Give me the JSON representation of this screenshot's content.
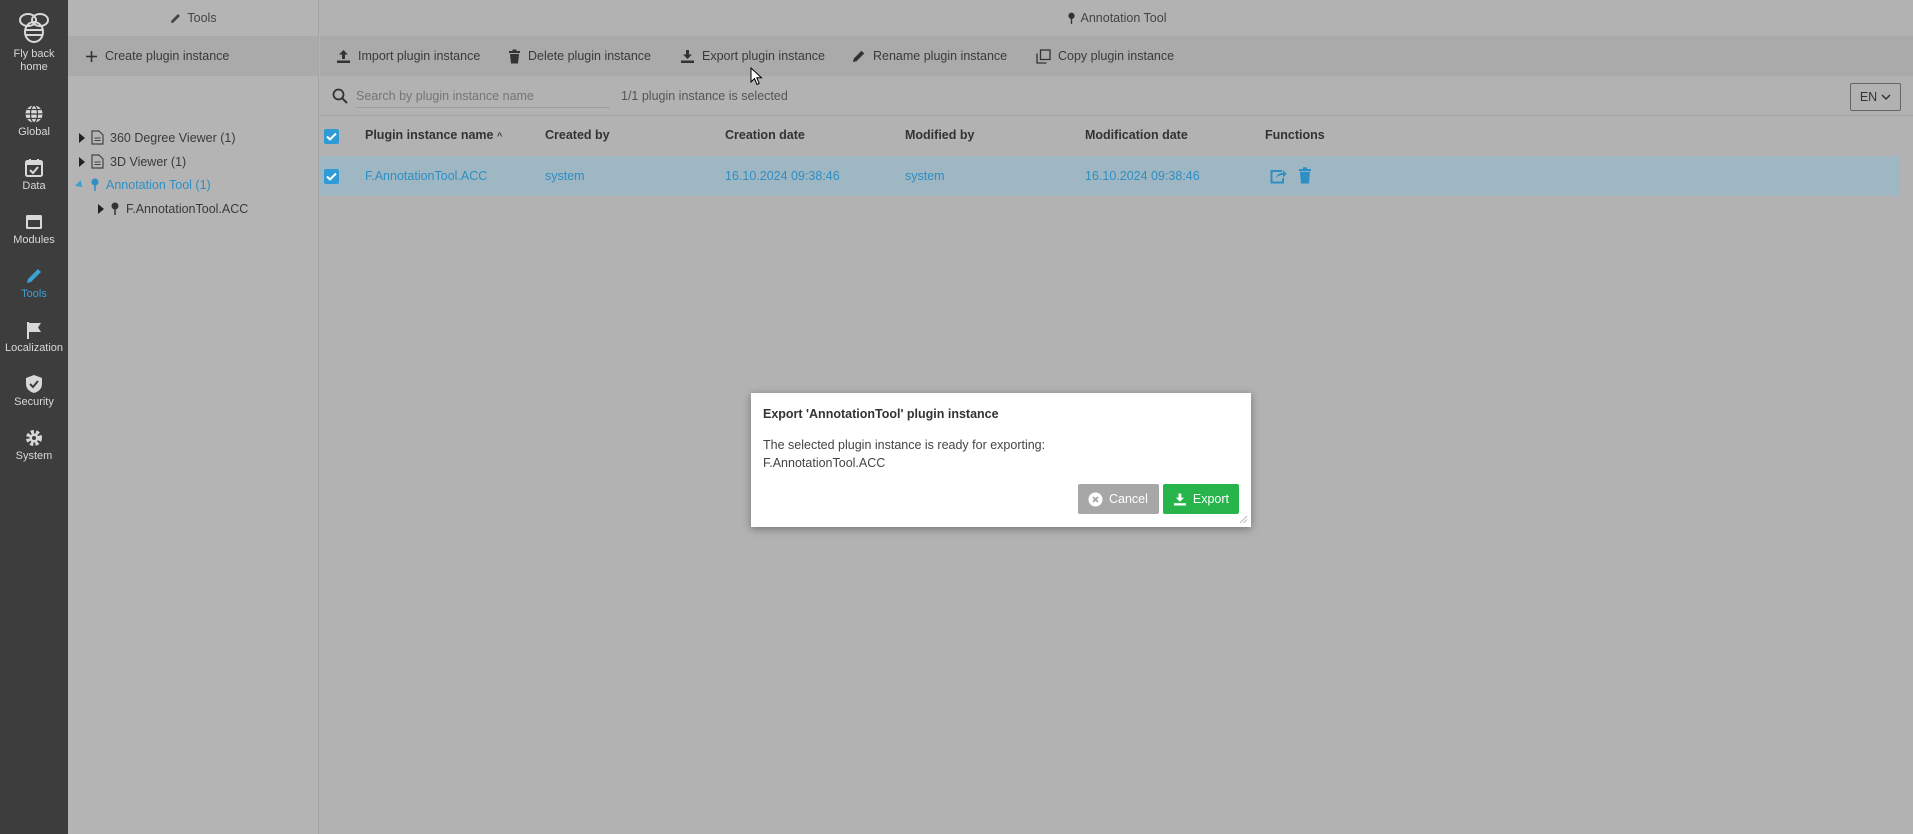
{
  "nav": {
    "items": [
      {
        "label_1": "Fly back",
        "label_2": "home",
        "icon": "bee-logo-icon"
      },
      {
        "label": "Global",
        "icon": "globe-icon"
      },
      {
        "label": "Data",
        "icon": "calendar-icon"
      },
      {
        "label": "Modules",
        "icon": "window-icon"
      },
      {
        "label": "Tools",
        "icon": "pencil-icon",
        "active": true
      },
      {
        "label": "Localization",
        "icon": "flag-icon"
      },
      {
        "label": "Security",
        "icon": "shield-icon"
      },
      {
        "label": "System",
        "icon": "gear-icon"
      }
    ]
  },
  "tree_panel": {
    "title": "Tools",
    "create_label": "Create plugin instance",
    "items": [
      {
        "label": "360 Degree Viewer (1)"
      },
      {
        "label": "3D Viewer (1)"
      },
      {
        "label": "Annotation Tool (1)"
      },
      {
        "label": "F.AnnotationTool.ACC"
      }
    ]
  },
  "main_panel": {
    "title": "Annotation Tool",
    "toolbar": {
      "import_label": "Import plugin instance",
      "delete_label": "Delete plugin instance",
      "export_label": "Export plugin instance",
      "rename_label": "Rename plugin instance",
      "copy_label": "Copy plugin instance"
    },
    "search": {
      "placeholder": "Search by plugin instance name",
      "selection_status": "1/1 plugin instance is selected"
    },
    "language": "EN",
    "table": {
      "headers": [
        "Plugin instance name",
        "Created by",
        "Creation date",
        "Modified by",
        "Modification date",
        "Functions"
      ],
      "rows": [
        {
          "name": "F.AnnotationTool.ACC",
          "created_by": "system",
          "creation_date": "16.10.2024 09:38:46",
          "modified_by": "system",
          "modification_date": "16.10.2024 09:38:46"
        }
      ]
    }
  },
  "dialog": {
    "title": "Export 'AnnotationTool' plugin instance",
    "message_1": "The selected plugin instance is ready for exporting:",
    "message_2": "F.AnnotationTool.ACC",
    "cancel_label": "Cancel",
    "export_label": "Export"
  },
  "colors": {
    "accent": "#3ca0d2",
    "export_green": "#27b44a",
    "nav_bg": "#3d3d3d"
  }
}
